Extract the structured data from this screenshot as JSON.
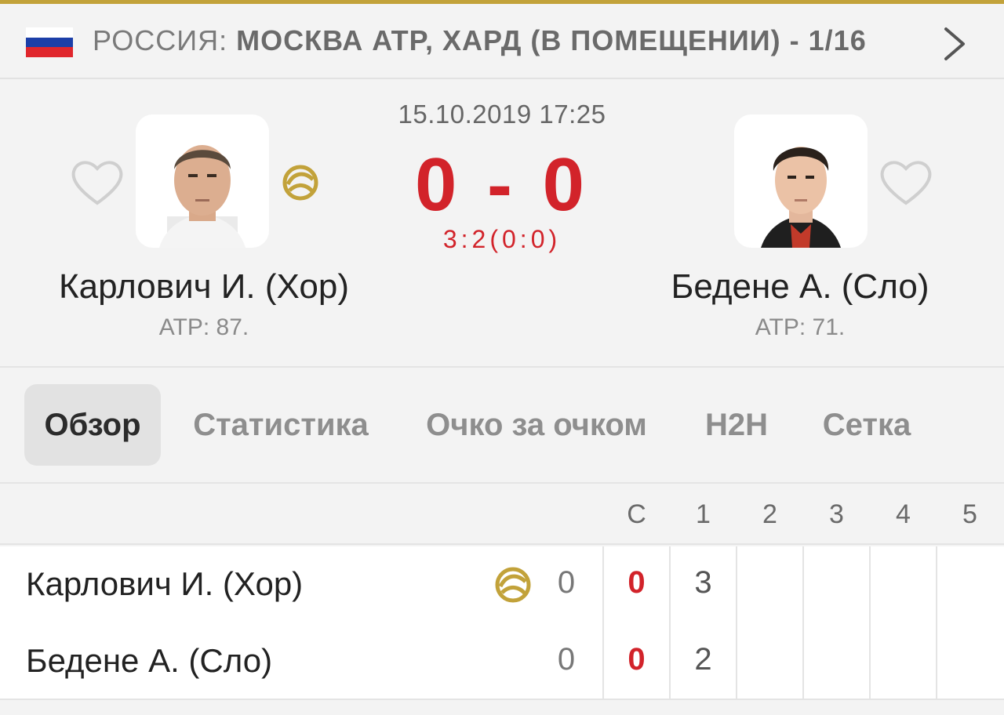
{
  "colors": {
    "accent_gold": "#c2a23a",
    "score_red": "#d2232a"
  },
  "header": {
    "flag_icon": "russia-flag-icon",
    "country": "РОССИЯ:",
    "tournament": "МОСКВА ATP, ХАРД (В ПОМЕЩЕНИИ) - 1/16"
  },
  "match": {
    "datetime": "15.10.2019 17:25",
    "score": "0 - 0",
    "subscore": "3:2(0:0)",
    "home": {
      "name": "Карлович И. (Хор)",
      "rank": "ATP: 87.",
      "serving": true
    },
    "away": {
      "name": "Бедене А. (Сло)",
      "rank": "ATP: 71.",
      "serving": false
    }
  },
  "tabs": [
    {
      "label": "Обзор",
      "active": true
    },
    {
      "label": "Статистика",
      "active": false
    },
    {
      "label": "Очко за очком",
      "active": false
    },
    {
      "label": "H2H",
      "active": false
    },
    {
      "label": "Сетка",
      "active": false
    }
  ],
  "scoreboard": {
    "columns": [
      "С",
      "1",
      "2",
      "3",
      "4",
      "5"
    ],
    "rows": [
      {
        "name": "Карлович И. (Хор)",
        "game": "0",
        "sets": "0",
        "set1": "3"
      },
      {
        "name": "Бедене А. (Сло)",
        "game": "0",
        "sets": "0",
        "set1": "2"
      }
    ]
  }
}
